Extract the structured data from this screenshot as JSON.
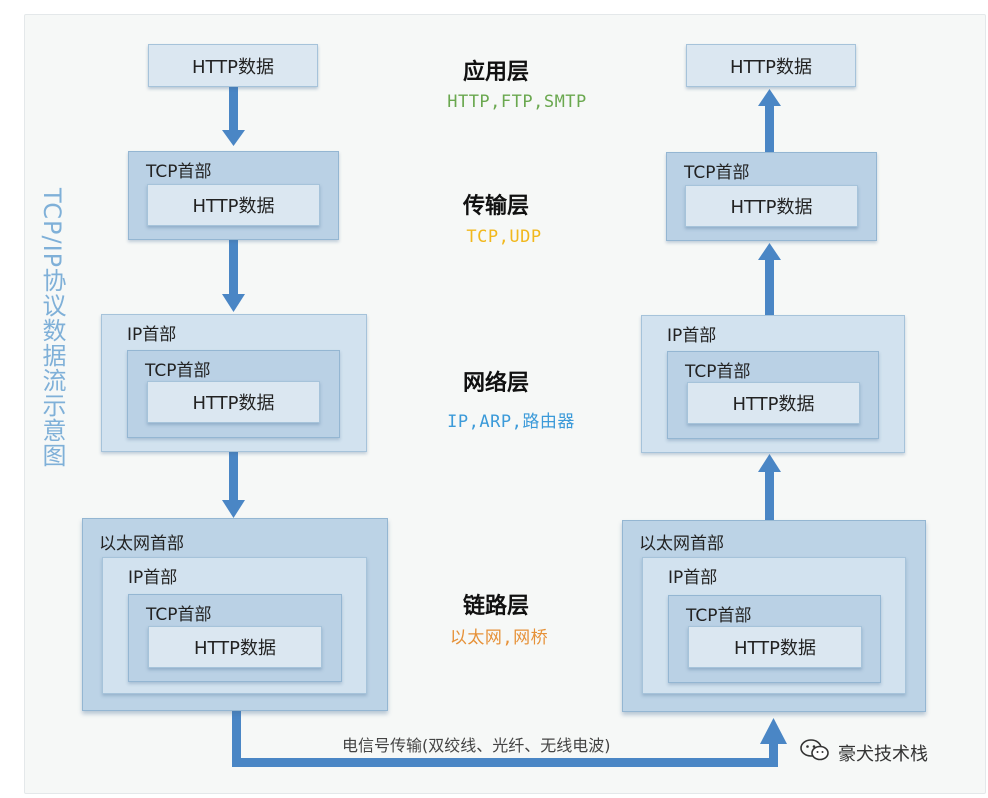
{
  "title": "TCP/IP协议数据流示意图",
  "labels": {
    "http_data": "HTTP数据",
    "tcp_header": "TCP首部",
    "ip_header": "IP首部",
    "eth_header": "以太网首部"
  },
  "layers": [
    {
      "name": "应用层",
      "protocols": "HTTP,FTP,SMTP",
      "color": "#6aa84f"
    },
    {
      "name": "传输层",
      "protocols": "TCP,UDP",
      "color": "#f1b81d"
    },
    {
      "name": "网络层",
      "protocols": "IP,ARP,路由器",
      "color": "#3b9ad9"
    },
    {
      "name": "链路层",
      "protocols": "以太网,网桥",
      "color": "#e69138"
    }
  ],
  "transmission_label": "电信号传输(双绞线、光纤、无线电波)",
  "watermark": {
    "icon": "wechat-icon",
    "text": "豪犬技术栈"
  },
  "colors": {
    "arrow": "#4a86c5",
    "title": "#7fb0d8"
  }
}
